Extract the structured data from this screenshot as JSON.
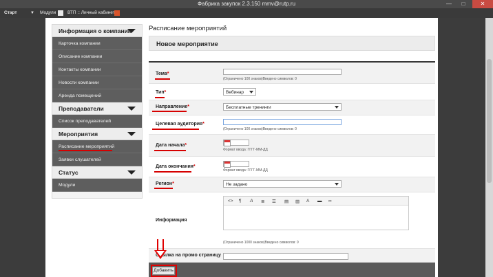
{
  "window": {
    "title": "Фабрика закупок 2.3.150 mmv@rutp.ru",
    "minimize": "—",
    "maximize": "□",
    "close": "✕"
  },
  "navbar": {
    "start": "Старт",
    "modules": "Модули",
    "cabinet": "ВТП :: Личный кабинет"
  },
  "sidebar": {
    "sections": [
      {
        "title": "Информация о компании",
        "items": [
          "Карточка компании",
          "Описание компании",
          "Контакты компании",
          "Новости компании",
          "Аренда помещений"
        ]
      },
      {
        "title": "Преподаватели",
        "items": [
          "Список преподавателей"
        ]
      },
      {
        "title": "Мероприятия",
        "items": [
          "Расписание мероприятий",
          "Заявки слушателей"
        ]
      },
      {
        "title": "Статус",
        "items": [
          "Модули"
        ]
      }
    ]
  },
  "main": {
    "page_title": "Расписание мероприятий",
    "form_title": "Новое мероприятие"
  },
  "form": {
    "topic_label": "Тема",
    "topic_hint": "(Ограничено 100 знаков)Введено символов: 0",
    "type_label": "Тип",
    "type_value": "Вебинар",
    "direction_label": "Направление",
    "direction_value": "Бесплатные тренинги",
    "audience_label": "Целевая аудитория",
    "audience_hint": "(Ограничено 100 знаков)Введено символов: 0",
    "start_label": "Дата начала",
    "start_hint": "Формат ввода: ГГГГ-ММ-ДД",
    "end_label": "Дата окончания",
    "end_hint": "Формат ввода: ГГГГ-ММ-ДД",
    "region_label": "Регион",
    "region_value": "Не задано",
    "info_label": "Информация",
    "info_hint": "(Ограничено 1000 знаков)Введено символов: 0",
    "promo_label": "Ссылка на промо страницу",
    "required_mark": "*",
    "toolbar": [
      "<>",
      "¶",
      "A",
      "≣",
      "☰",
      "▤",
      "▥",
      "A",
      "▬",
      "∞"
    ]
  },
  "actions": {
    "add_label": "Добавить"
  },
  "colors": {
    "annotation_red": "#e00000",
    "sidebar_active": "#5e5e5e"
  }
}
